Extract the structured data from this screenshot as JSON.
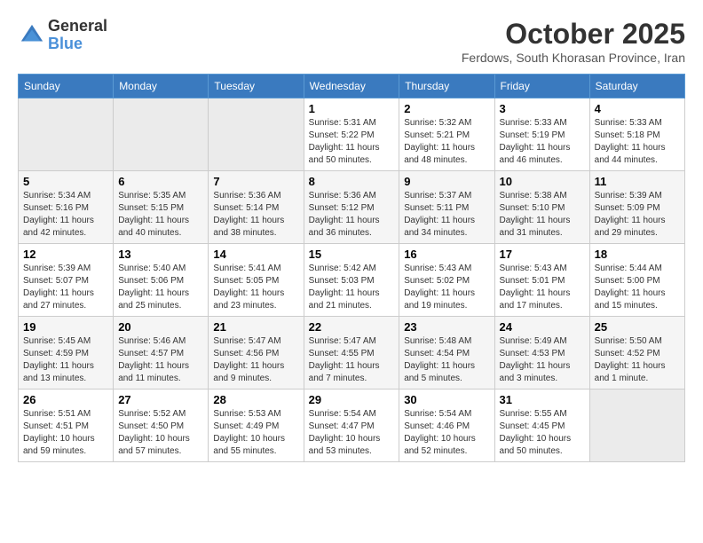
{
  "header": {
    "logo_general": "General",
    "logo_blue": "Blue",
    "month": "October 2025",
    "location": "Ferdows, South Khorasan Province, Iran"
  },
  "weekdays": [
    "Sunday",
    "Monday",
    "Tuesday",
    "Wednesday",
    "Thursday",
    "Friday",
    "Saturday"
  ],
  "weeks": [
    [
      {
        "day": "",
        "info": ""
      },
      {
        "day": "",
        "info": ""
      },
      {
        "day": "",
        "info": ""
      },
      {
        "day": "1",
        "info": "Sunrise: 5:31 AM\nSunset: 5:22 PM\nDaylight: 11 hours\nand 50 minutes."
      },
      {
        "day": "2",
        "info": "Sunrise: 5:32 AM\nSunset: 5:21 PM\nDaylight: 11 hours\nand 48 minutes."
      },
      {
        "day": "3",
        "info": "Sunrise: 5:33 AM\nSunset: 5:19 PM\nDaylight: 11 hours\nand 46 minutes."
      },
      {
        "day": "4",
        "info": "Sunrise: 5:33 AM\nSunset: 5:18 PM\nDaylight: 11 hours\nand 44 minutes."
      }
    ],
    [
      {
        "day": "5",
        "info": "Sunrise: 5:34 AM\nSunset: 5:16 PM\nDaylight: 11 hours\nand 42 minutes."
      },
      {
        "day": "6",
        "info": "Sunrise: 5:35 AM\nSunset: 5:15 PM\nDaylight: 11 hours\nand 40 minutes."
      },
      {
        "day": "7",
        "info": "Sunrise: 5:36 AM\nSunset: 5:14 PM\nDaylight: 11 hours\nand 38 minutes."
      },
      {
        "day": "8",
        "info": "Sunrise: 5:36 AM\nSunset: 5:12 PM\nDaylight: 11 hours\nand 36 minutes."
      },
      {
        "day": "9",
        "info": "Sunrise: 5:37 AM\nSunset: 5:11 PM\nDaylight: 11 hours\nand 34 minutes."
      },
      {
        "day": "10",
        "info": "Sunrise: 5:38 AM\nSunset: 5:10 PM\nDaylight: 11 hours\nand 31 minutes."
      },
      {
        "day": "11",
        "info": "Sunrise: 5:39 AM\nSunset: 5:09 PM\nDaylight: 11 hours\nand 29 minutes."
      }
    ],
    [
      {
        "day": "12",
        "info": "Sunrise: 5:39 AM\nSunset: 5:07 PM\nDaylight: 11 hours\nand 27 minutes."
      },
      {
        "day": "13",
        "info": "Sunrise: 5:40 AM\nSunset: 5:06 PM\nDaylight: 11 hours\nand 25 minutes."
      },
      {
        "day": "14",
        "info": "Sunrise: 5:41 AM\nSunset: 5:05 PM\nDaylight: 11 hours\nand 23 minutes."
      },
      {
        "day": "15",
        "info": "Sunrise: 5:42 AM\nSunset: 5:03 PM\nDaylight: 11 hours\nand 21 minutes."
      },
      {
        "day": "16",
        "info": "Sunrise: 5:43 AM\nSunset: 5:02 PM\nDaylight: 11 hours\nand 19 minutes."
      },
      {
        "day": "17",
        "info": "Sunrise: 5:43 AM\nSunset: 5:01 PM\nDaylight: 11 hours\nand 17 minutes."
      },
      {
        "day": "18",
        "info": "Sunrise: 5:44 AM\nSunset: 5:00 PM\nDaylight: 11 hours\nand 15 minutes."
      }
    ],
    [
      {
        "day": "19",
        "info": "Sunrise: 5:45 AM\nSunset: 4:59 PM\nDaylight: 11 hours\nand 13 minutes."
      },
      {
        "day": "20",
        "info": "Sunrise: 5:46 AM\nSunset: 4:57 PM\nDaylight: 11 hours\nand 11 minutes."
      },
      {
        "day": "21",
        "info": "Sunrise: 5:47 AM\nSunset: 4:56 PM\nDaylight: 11 hours\nand 9 minutes."
      },
      {
        "day": "22",
        "info": "Sunrise: 5:47 AM\nSunset: 4:55 PM\nDaylight: 11 hours\nand 7 minutes."
      },
      {
        "day": "23",
        "info": "Sunrise: 5:48 AM\nSunset: 4:54 PM\nDaylight: 11 hours\nand 5 minutes."
      },
      {
        "day": "24",
        "info": "Sunrise: 5:49 AM\nSunset: 4:53 PM\nDaylight: 11 hours\nand 3 minutes."
      },
      {
        "day": "25",
        "info": "Sunrise: 5:50 AM\nSunset: 4:52 PM\nDaylight: 11 hours\nand 1 minute."
      }
    ],
    [
      {
        "day": "26",
        "info": "Sunrise: 5:51 AM\nSunset: 4:51 PM\nDaylight: 10 hours\nand 59 minutes."
      },
      {
        "day": "27",
        "info": "Sunrise: 5:52 AM\nSunset: 4:50 PM\nDaylight: 10 hours\nand 57 minutes."
      },
      {
        "day": "28",
        "info": "Sunrise: 5:53 AM\nSunset: 4:49 PM\nDaylight: 10 hours\nand 55 minutes."
      },
      {
        "day": "29",
        "info": "Sunrise: 5:54 AM\nSunset: 4:47 PM\nDaylight: 10 hours\nand 53 minutes."
      },
      {
        "day": "30",
        "info": "Sunrise: 5:54 AM\nSunset: 4:46 PM\nDaylight: 10 hours\nand 52 minutes."
      },
      {
        "day": "31",
        "info": "Sunrise: 5:55 AM\nSunset: 4:45 PM\nDaylight: 10 hours\nand 50 minutes."
      },
      {
        "day": "",
        "info": ""
      }
    ]
  ]
}
